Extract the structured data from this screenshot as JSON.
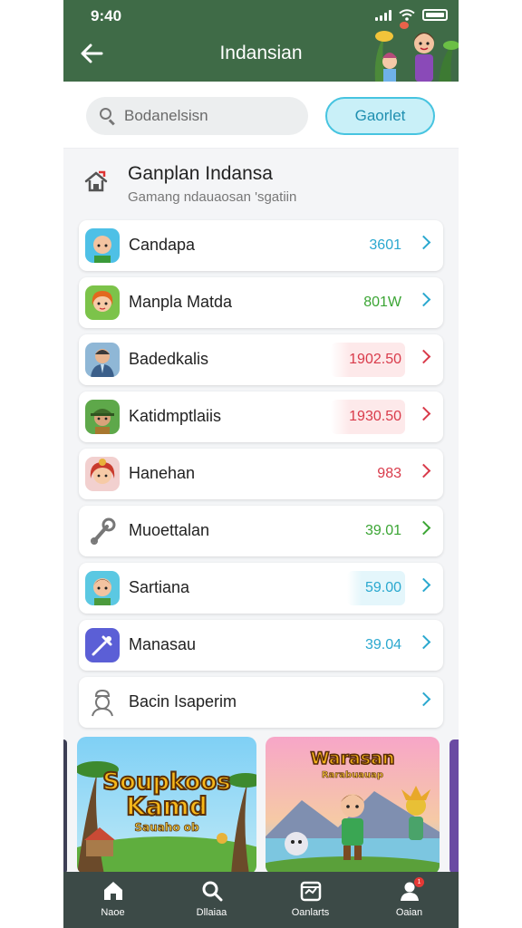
{
  "status_bar": {
    "time": "9:40"
  },
  "header": {
    "title": "Indansian",
    "back_icon": "arrow-left-icon"
  },
  "search": {
    "placeholder": "Bodanelsisn",
    "icon": "search-icon"
  },
  "action_button": {
    "label": "Gaorlet"
  },
  "section": {
    "title": "Ganplan Indansa",
    "subtitle": "Gamang ndauaosan 'sgatiin",
    "icon": "house-icon"
  },
  "list_items": [
    {
      "label": "Candapa",
      "value": "3601",
      "value_color": "#2aa8cf",
      "chevron_color": "#2aa8cf",
      "highlight": "",
      "avatar": "avatar-boy-icon"
    },
    {
      "label": "Manpla Matda",
      "value": "801W",
      "value_color": "#3ba534",
      "chevron_color": "#2aa8cf",
      "highlight": "",
      "avatar": "avatar-girl-icon"
    },
    {
      "label": "Badedkalis",
      "value": "1902.50",
      "value_color": "#d93a4a",
      "chevron_color": "#d93a4a",
      "highlight": "red",
      "avatar": "avatar-man-icon"
    },
    {
      "label": "Katidmptlaiis",
      "value": "1930.50",
      "value_color": "#d93a4a",
      "chevron_color": "#d93a4a",
      "highlight": "red",
      "avatar": "avatar-hat-boy-icon"
    },
    {
      "label": "Hanehan",
      "value": "983",
      "value_color": "#d93a4a",
      "chevron_color": "#d93a4a",
      "highlight": "",
      "avatar": "avatar-girl-red-icon"
    },
    {
      "label": "Muoettalan",
      "value": "39.01",
      "value_color": "#3ba534",
      "chevron_color": "#3ba534",
      "highlight": "",
      "avatar": "wrench-icon"
    },
    {
      "label": "Sartiana",
      "value": "59.00",
      "value_color": "#2aa8cf",
      "chevron_color": "#2aa8cf",
      "highlight": "cyan",
      "avatar": "avatar-boy-icon"
    },
    {
      "label": "Manasau",
      "value": "39.04",
      "value_color": "#2aa8cf",
      "chevron_color": "#2aa8cf",
      "highlight": "",
      "avatar": "tools-icon"
    },
    {
      "label": "Bacin Isaperim",
      "value": "",
      "value_color": "#2aa8cf",
      "chevron_color": "#2aa8cf",
      "highlight": "",
      "avatar": "chef-icon"
    }
  ],
  "banners": [
    {
      "title_line1": "Soupkoos",
      "title_line2": "Kamd",
      "title_line3": "Sauaho ob"
    },
    {
      "title_line1": "Warasan",
      "title_line2": "Rarabuauap"
    }
  ],
  "bottom_nav": [
    {
      "label": "Naoe",
      "icon": "home-icon"
    },
    {
      "label": "Dllaiaa",
      "icon": "search-icon"
    },
    {
      "label": "Oanlarts",
      "icon": "calendar-icon"
    },
    {
      "label": "Oaian",
      "icon": "profile-icon",
      "badge": "1"
    }
  ],
  "colors": {
    "header_bg": "#3f6b47",
    "accent_cyan": "#47c4e0",
    "nav_bg": "#3c4a47"
  }
}
